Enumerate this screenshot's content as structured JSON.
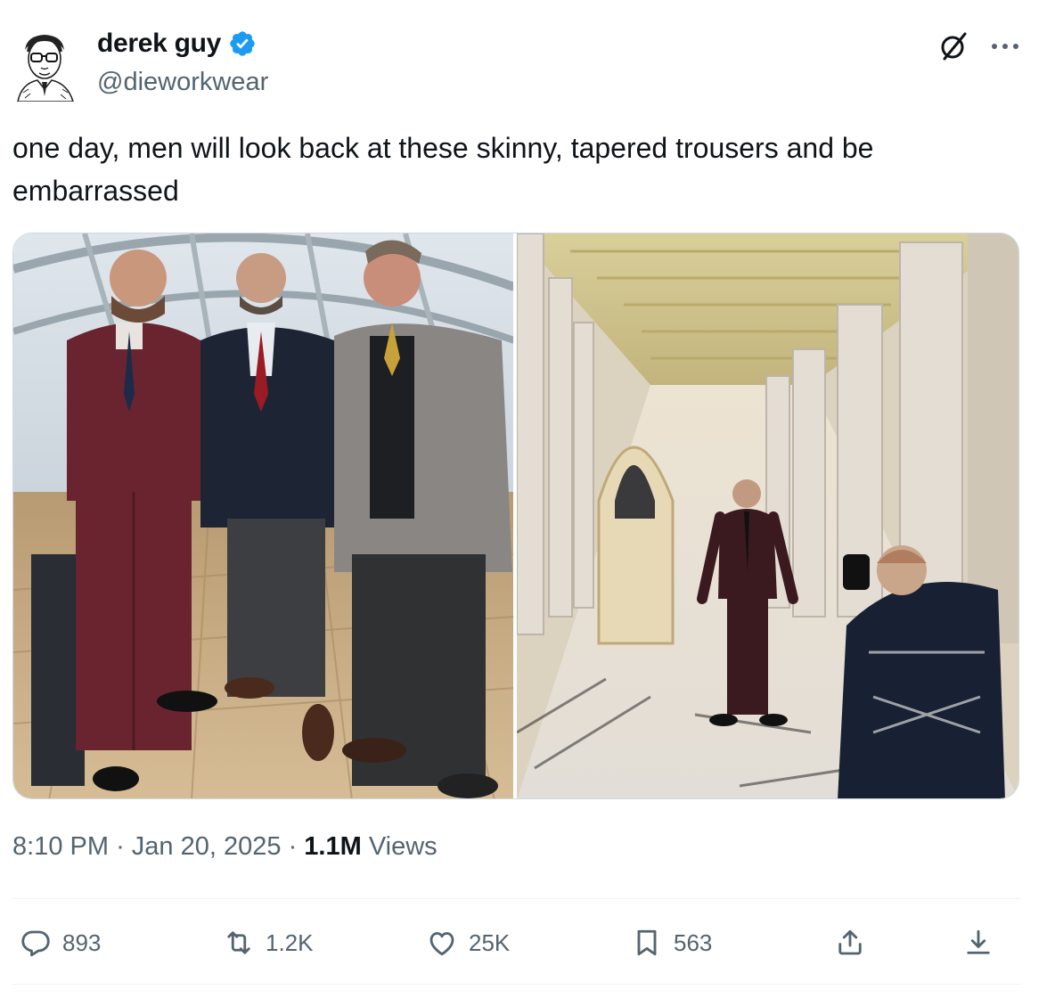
{
  "author": {
    "display_name": "derek guy",
    "handle": "@dieworkwear",
    "verified": true
  },
  "tweet": {
    "text": "one day, men will look back at these skinny, tapered trousers and be embarrassed"
  },
  "meta": {
    "time": "8:10 PM",
    "separator": "·",
    "date": "Jan 20, 2025",
    "views_count": "1.1M",
    "views_label": "Views"
  },
  "actions": {
    "replies": "893",
    "reposts": "1.2K",
    "likes": "25K",
    "bookmarks": "563"
  },
  "icons": [
    "verified-badge-icon",
    "grok-icon",
    "more-icon",
    "reply-icon",
    "repost-icon",
    "like-icon",
    "bookmark-icon",
    "share-icon"
  ],
  "colors": {
    "verified": "#1d9bf0",
    "text_primary": "#0f1419",
    "text_secondary": "#536471",
    "border": "#cfd9de"
  }
}
